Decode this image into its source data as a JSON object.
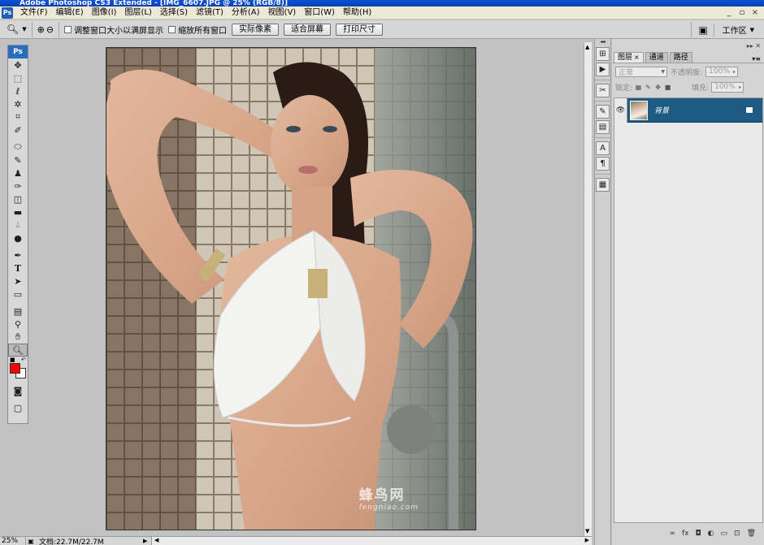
{
  "window": {
    "title": "Adobe Photoshop CS3 Extended - [IMG_6607.JPG @ 25% (RGB/8)]",
    "controls": [
      "_",
      "▫",
      "×"
    ]
  },
  "menu": [
    "文件(F)",
    "编辑(E)",
    "图像(I)",
    "图层(L)",
    "选择(S)",
    "滤镜(T)",
    "分析(A)",
    "视图(V)",
    "窗口(W)",
    "帮助(H)"
  ],
  "options": {
    "resize_windows_label": "调整窗口大小以满屏显示",
    "zoom_all_label": "缩放所有窗口",
    "actual_pixels": "实际像素",
    "fit_screen": "适合屏幕",
    "print_size": "打印尺寸",
    "workspace": "工作区"
  },
  "tools_badge": "Ps",
  "canvas": {
    "watermark_cn": "蜂鸟网",
    "watermark_en": "fengniao.com"
  },
  "status": {
    "zoom": "25%",
    "doc_info": "文档:22.7M/22.7M"
  },
  "layers_panel": {
    "tabs": [
      "图层",
      "通道",
      "路径"
    ],
    "blend_mode": "正常",
    "opacity_label": "不透明度:",
    "opacity_value": "100%",
    "lock_label": "锁定:",
    "fill_label": "填充:",
    "fill_value": "100%",
    "layer_name": "背景",
    "bottom_icons": [
      "∞",
      "fx",
      "◘",
      "◐",
      "▭",
      "⊡",
      "🗑"
    ]
  },
  "colors": {
    "foreground": "#ff0000",
    "background": "#ffffff",
    "selected_layer": "#1d5a84"
  }
}
